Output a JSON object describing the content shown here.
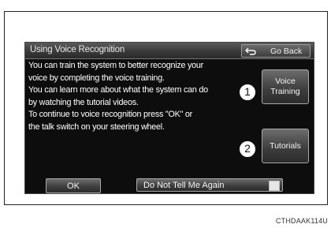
{
  "screen": {
    "title": "Using Voice Recognition",
    "back_button": {
      "icon": "return-arrow-icon",
      "label": "Go Back"
    },
    "body_lines": [
      "You can train the system to better recognize your",
      "voice by completing the voice training.",
      "You can learn more about what the system can do",
      "by watching the tutorial videos.",
      "To continue to voice recognition press \"OK\" or",
      "the talk switch on your steering wheel."
    ],
    "voice_training_button": {
      "line1": "Voice",
      "line2": "Training"
    },
    "tutorials_button": {
      "label": "Tutorials"
    },
    "ok_button": {
      "label": "OK"
    },
    "do_not_tell_button": {
      "label": "Do Not Tell Me Again",
      "checked": false
    }
  },
  "callouts": [
    "1",
    "2"
  ],
  "caption": "CTHDAAK114U",
  "colors": {
    "screen_bg": "#0d0d0d",
    "button": "#4a4a4a",
    "text": "#ffffff"
  }
}
